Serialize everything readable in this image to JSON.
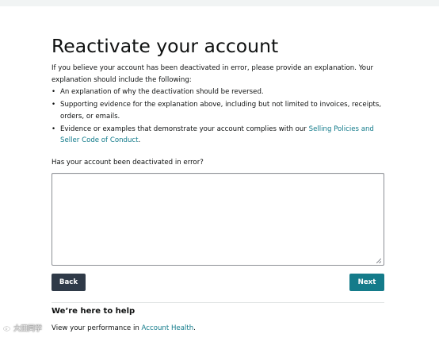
{
  "page": {
    "title": "Reactivate your account",
    "intro": "If you believe your account has been deactivated in error, please provide an explanation. Your explanation should include the following:",
    "requirements": [
      {
        "text": "An explanation of why the deactivation should be reversed."
      },
      {
        "text": "Supporting evidence for the explanation above, including but not limited to invoices, receipts, orders, or emails."
      },
      {
        "text_before": "Evidence or examples that demonstrate your account complies with our ",
        "link": "Selling Policies and Seller Code of Conduct",
        "text_after": "."
      }
    ],
    "question_label": "Has your account been deactivated in error?",
    "explanation_value": ""
  },
  "actions": {
    "back_label": "Back",
    "next_label": "Next"
  },
  "help": {
    "title": "We’re here to help",
    "text_before": "View your performance in ",
    "link": "Account Health",
    "text_after": "."
  },
  "watermark": {
    "text": "大田同学",
    "icon": "weibo-icon"
  },
  "colors": {
    "accent": "#147b8a",
    "link": "#117a8a",
    "back_button": "#2f3a48",
    "text": "#0f1111",
    "border": "#8d9096"
  }
}
